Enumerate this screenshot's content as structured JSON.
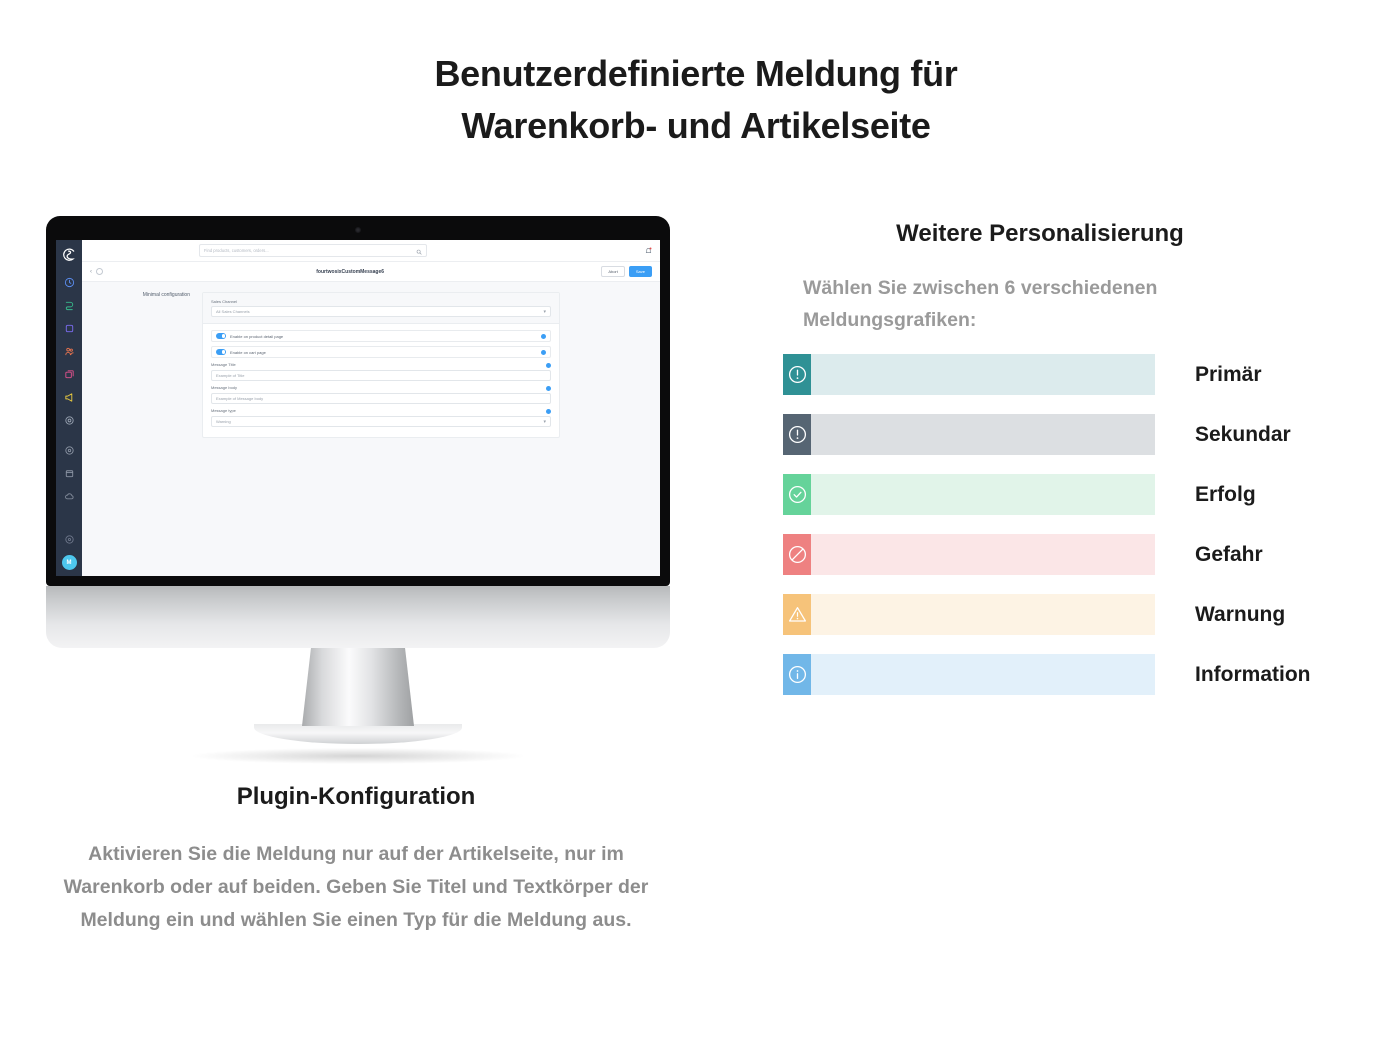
{
  "headline": {
    "line1": "Benutzerdefinierte Meldung für",
    "line2": "Warenkorb- und Artikelseite"
  },
  "caption": {
    "title": "Plugin-Konfiguration",
    "body": "Aktivieren Sie die Meldung nur auf der Artikelseite, nur im Warenkorb oder auf beiden. Geben Sie Titel und Textkörper der Meldung ein und wählen Sie einen Typ für die Meldung aus."
  },
  "right_panel": {
    "title": "Weitere Personalisierung",
    "subtitle": "Wählen Sie zwischen 6 verschiedenen Meldungsgrafiken:",
    "alerts": [
      {
        "label": "Primär",
        "icon": "exclamation-circle-icon",
        "icon_bg": "#2f9195",
        "body_bg": "#dcebed"
      },
      {
        "label": "Sekundar",
        "icon": "exclamation-circle-icon",
        "icon_bg": "#566573",
        "body_bg": "#dcdfe2"
      },
      {
        "label": "Erfolg",
        "icon": "check-circle-icon",
        "icon_bg": "#65d39a",
        "body_bg": "#e1f4e9"
      },
      {
        "label": "Gefahr",
        "icon": "ban-circle-icon",
        "icon_bg": "#ee8181",
        "body_bg": "#fbe6e7"
      },
      {
        "label": "Warnung",
        "icon": "warning-triangle-icon",
        "icon_bg": "#f6c37a",
        "body_bg": "#fdf3e4"
      },
      {
        "label": "Information",
        "icon": "info-circle-icon",
        "icon_bg": "#71b7e8",
        "body_bg": "#e2f0fa"
      }
    ]
  },
  "admin": {
    "logo_name": "shopware-logo-icon",
    "search": {
      "placeholder": "Find products, customers, orders..."
    },
    "smartbar": {
      "title": "fourtwosixCustomMessage6",
      "abort_label": "Abort",
      "save_label": "Save"
    },
    "section_label": "Minimal configuration",
    "sales_channel": {
      "label": "Sales Channel",
      "value": "All Sales Channels"
    },
    "toggles": [
      {
        "label": "Enable on product detail page",
        "on": true
      },
      {
        "label": "Enable on cart page",
        "on": true
      }
    ],
    "fields": [
      {
        "label": "Message Title",
        "value": "Example of Title",
        "type": "input"
      },
      {
        "label": "Message body",
        "value": "Example of Message body",
        "type": "input"
      },
      {
        "label": "Message type",
        "value": "Warning",
        "type": "select"
      }
    ],
    "sidebar_icons": [
      "dashboard-icon",
      "catalogue-icon",
      "orders-icon",
      "customers-icon",
      "content-icon",
      "marketing-icon",
      "extensions-icon",
      "settings-icon",
      "storefront-icon",
      "cloud-icon"
    ],
    "avatar_initials": "M"
  },
  "colors": {
    "accent_blue": "#3b9ef5",
    "sidebar_bg": "#2b3648",
    "avatar_bg": "#4dc7ed"
  }
}
